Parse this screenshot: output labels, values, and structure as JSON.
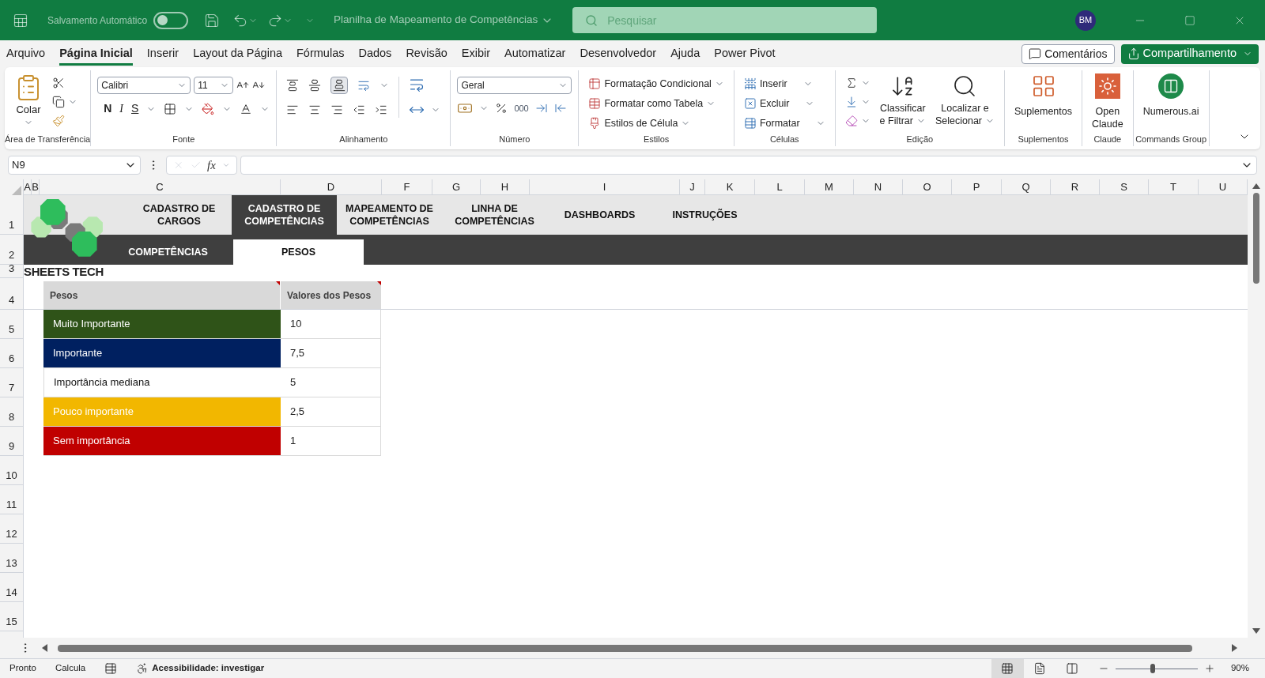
{
  "title_bar": {
    "autosave_label": "Salvamento Automático",
    "autosave_on": false,
    "document_title": "Planilha de Mapeamento de Competências",
    "search_placeholder": "Pesquisar",
    "avatar": "BM"
  },
  "menu_tabs": [
    {
      "label": "Arquivo",
      "selected": false
    },
    {
      "label": "Página Inicial",
      "selected": true
    },
    {
      "label": "Inserir",
      "selected": false
    },
    {
      "label": "Layout da Página",
      "selected": false
    },
    {
      "label": "Fórmulas",
      "selected": false
    },
    {
      "label": "Dados",
      "selected": false
    },
    {
      "label": "Revisão",
      "selected": false
    },
    {
      "label": "Exibir",
      "selected": false
    },
    {
      "label": "Automatizar",
      "selected": false
    },
    {
      "label": "Desenvolvedor",
      "selected": false
    },
    {
      "label": "Ajuda",
      "selected": false
    },
    {
      "label": "Power Pivot",
      "selected": false
    }
  ],
  "comments_button": "Comentários",
  "share_button": "Compartilhamento",
  "ribbon": [
    {
      "kind": "clipboard",
      "name": "Área de Transferência",
      "label": "Colar"
    },
    {
      "kind": "font",
      "name": "Fonte",
      "font": "Calibri",
      "size": "11",
      "bold": "N",
      "italic": "I",
      "underline": "S"
    },
    {
      "kind": "alignment",
      "name": "Alinhamento"
    },
    {
      "kind": "number",
      "name": "Número",
      "format": "Geral",
      "thousands": "000"
    },
    {
      "kind": "styles",
      "name": "Estilos",
      "items": [
        "Formatação Condicional",
        "Formatar como Tabela",
        "Estilos de Célula"
      ]
    },
    {
      "kind": "cells",
      "name": "Células",
      "items": [
        "Inserir",
        "Excluir",
        "Formatar"
      ]
    },
    {
      "kind": "editing",
      "name": "Edição",
      "items": [
        [
          "Classificar",
          "e Filtrar"
        ],
        [
          "Localizar e",
          "Selecionar"
        ]
      ]
    },
    {
      "kind": "addins",
      "name": "Suplementos",
      "label": [
        "Suplementos"
      ]
    },
    {
      "kind": "claude",
      "name": "Claude",
      "label": [
        "Open",
        "Claude"
      ]
    },
    {
      "kind": "numerous",
      "name": "Commands Group",
      "label": [
        "Numerous.ai"
      ]
    }
  ],
  "formula_bar": {
    "name_box": "N9",
    "function_label": "fx"
  },
  "columns": [
    "A",
    "B",
    "C",
    "D",
    "F",
    "G",
    "H",
    "I",
    "J",
    "K",
    "L",
    "M",
    "N",
    "O",
    "P",
    "Q",
    "R",
    "S",
    "T",
    "U"
  ],
  "rows": [
    "1",
    "2",
    "3",
    "4",
    "5",
    "6",
    "7",
    "8",
    "9",
    "10",
    "11",
    "12",
    "13",
    "14",
    "15"
  ],
  "sheet": {
    "nav_tabs": [
      {
        "label": "CADASTRO DE CARGOS",
        "selected": false
      },
      {
        "label": "CADASTRO DE COMPETÊNCIAS",
        "selected": true
      },
      {
        "label": "MAPEAMENTO DE COMPETÊNCIAS",
        "selected": false
      },
      {
        "label": "LINHA DE COMPETÊNCIAS",
        "selected": false
      },
      {
        "label": "DASHBOARDS",
        "selected": false
      },
      {
        "label": "INSTRUÇÕES",
        "selected": false
      }
    ],
    "sub_tabs": [
      {
        "label": "COMPETÊNCIAS",
        "selected": false
      },
      {
        "label": "PESOS",
        "selected": true
      }
    ],
    "logo_text": "SHEETS TECH",
    "table": {
      "columns": [
        "Pesos",
        "Valores dos Pesos"
      ],
      "rows": [
        {
          "label": "Muito Importante",
          "value": "10",
          "color": "#2f5318"
        },
        {
          "label": "Importante",
          "value": "7,5",
          "color": "#002060"
        },
        {
          "label": "Importância mediana",
          "value": "5",
          "color": "#ffffff"
        },
        {
          "label": "Pouco importante",
          "value": "2,5",
          "color": "#f2b700"
        },
        {
          "label": "Sem importância",
          "value": "1",
          "color": "#c00000"
        }
      ]
    }
  },
  "status_bar": {
    "ready": "Pronto",
    "calculate": "Calcula",
    "accessibility": "Acessibilidade: investigar",
    "views": [
      {
        "kind": "normal",
        "selected": true
      },
      {
        "kind": "page_layout",
        "selected": false
      },
      {
        "kind": "page_break",
        "selected": false
      }
    ],
    "zoom": {
      "level": 0.45,
      "reading": "90%"
    }
  }
}
